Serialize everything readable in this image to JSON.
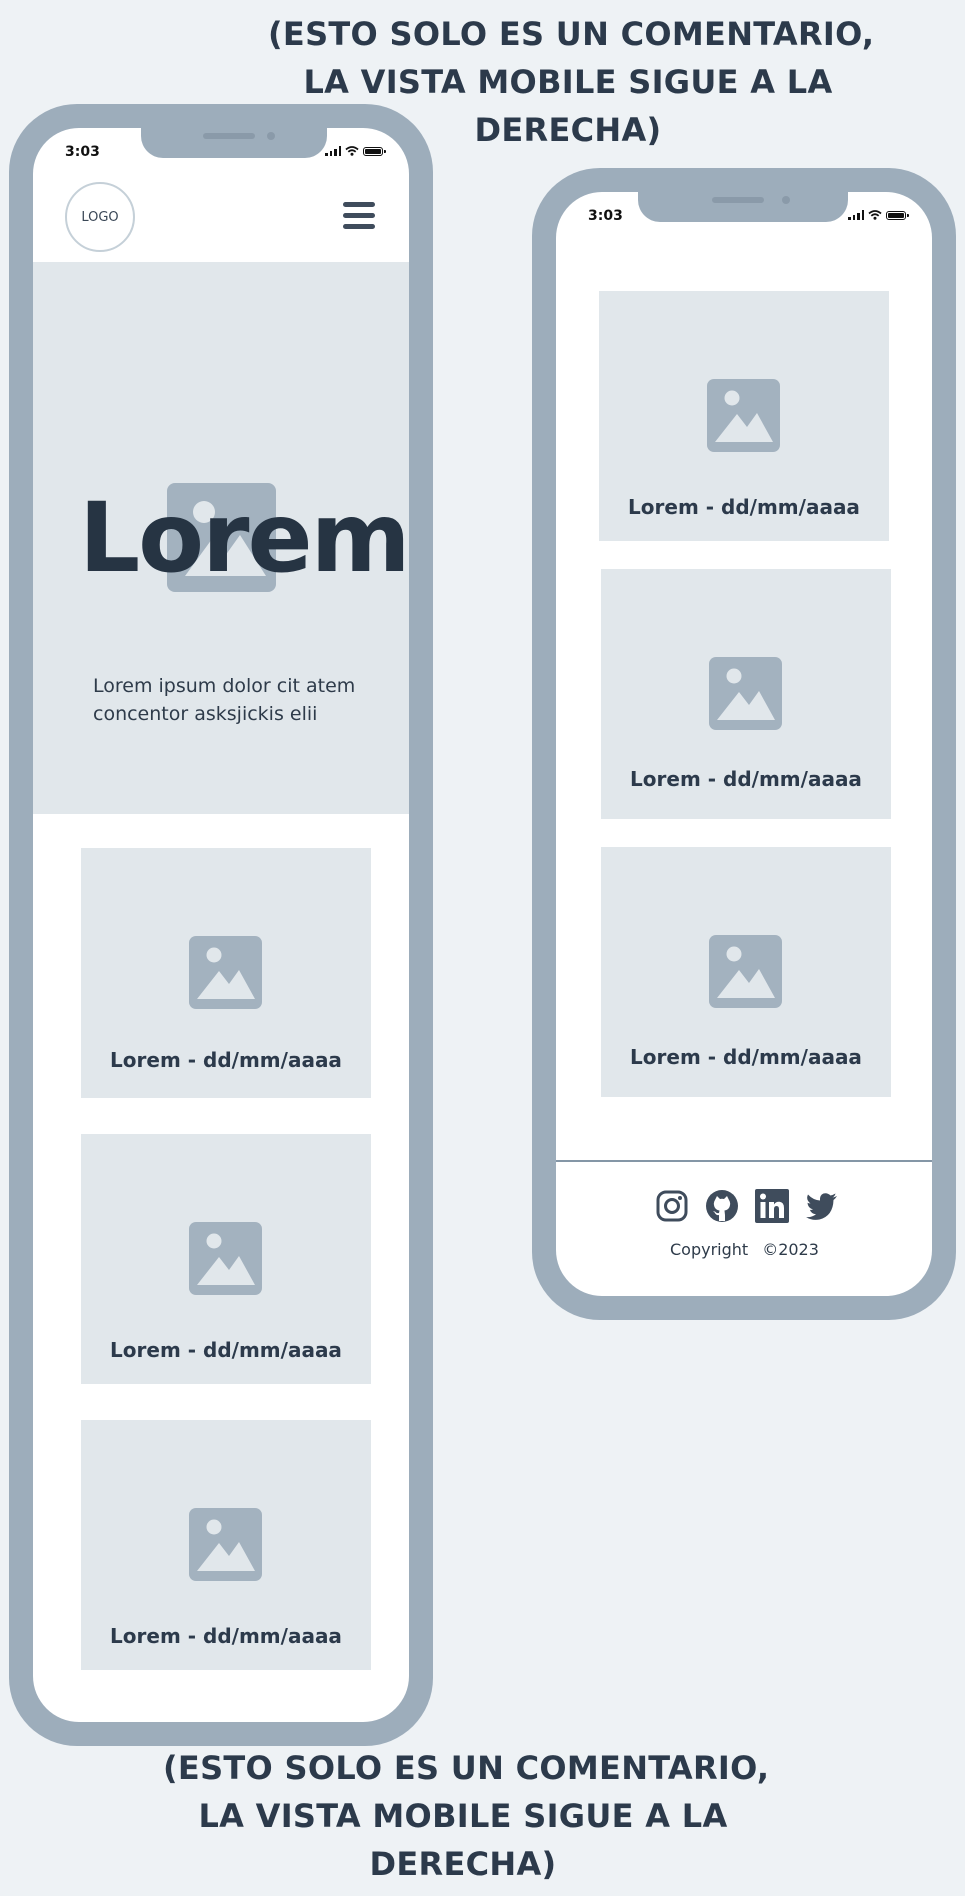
{
  "comment_lines": [
    "(ESTO SOLO ES UN COMENTARIO,",
    "LA VISTA MOBILE SIGUE A LA",
    "DERECHA)"
  ],
  "status_time": "3:03",
  "header": {
    "logo_text": "LOGO"
  },
  "hero": {
    "title": "Lorem",
    "text_lines": [
      "Lorem ipsum dolor cit atem",
      "concentor asksjickis elii"
    ]
  },
  "cards_left": [
    {
      "caption": "Lorem - dd/mm/aaaa"
    },
    {
      "caption": "Lorem - dd/mm/aaaa"
    },
    {
      "caption": "Lorem - dd/mm/aaaa"
    }
  ],
  "cards_right": [
    {
      "caption": "Lorem - dd/mm/aaaa"
    },
    {
      "caption": "Lorem - dd/mm/aaaa"
    },
    {
      "caption": "Lorem - dd/mm/aaaa"
    }
  ],
  "footer": {
    "social_icons": [
      "instagram-icon",
      "github-icon",
      "linkedin-icon",
      "twitter-icon"
    ],
    "copyright_label": "Copyright",
    "copyright_year": "©2023"
  },
  "colors": {
    "page_bg": "#eef2f5",
    "phone_frame": "#9dadbb",
    "placeholder_bg": "#e1e7eb",
    "image_icon": "#a3b2bf",
    "text_dark": "#2c3a4b"
  }
}
